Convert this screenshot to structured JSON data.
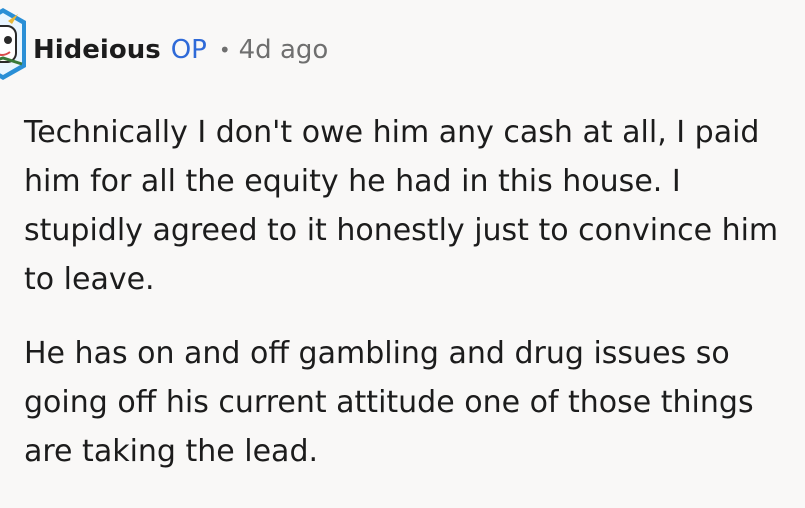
{
  "comment": {
    "author": "Hideious",
    "op_badge": "OP",
    "separator": "•",
    "age": "4d ago",
    "paragraphs": [
      "Technically I don't owe him any cash at all, I paid him for all the equity he had in this house. I stupidly agreed to it honestly just to convince him to leave.",
      "He has on and off gambling and drug issues so going off his current attitude one of those things are taking the lead."
    ],
    "avatar_icon": "snoo-avatar-icon"
  },
  "colors": {
    "background": "#f9f8f7",
    "text": "#1c1c1c",
    "op_badge": "#2f6ad8",
    "meta": "#6f6f6f"
  }
}
